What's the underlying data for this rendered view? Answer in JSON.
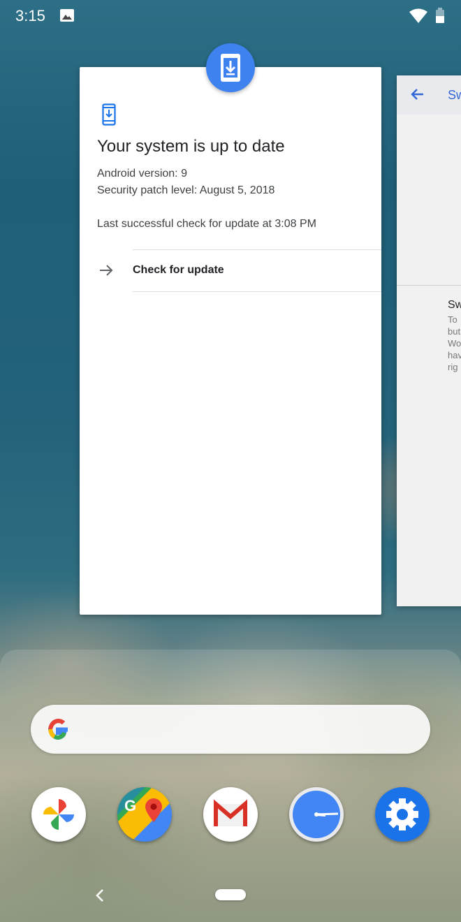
{
  "status_bar": {
    "time": "3:15",
    "notification_icon": "image-icon",
    "wifi_icon": "wifi-icon",
    "battery_icon": "battery-icon"
  },
  "recents": {
    "active_card": {
      "app_icon": "system-update-icon",
      "header_icon": "phone-download-icon",
      "title": "Your system is up to date",
      "android_version": "Android version: 9",
      "security_patch": "Security patch level: August 5, 2018",
      "last_check": "Last successful check for update at 3:08 PM",
      "action_label": "Check for update"
    },
    "next_card": {
      "title": "Sw",
      "heading": "Sw",
      "lines": [
        "To",
        "but",
        "Wo",
        "hav",
        "rig"
      ]
    }
  },
  "dock": {
    "search_logo": "google-g-logo",
    "apps": [
      {
        "name": "photos-app-icon"
      },
      {
        "name": "maps-app-icon"
      },
      {
        "name": "gmail-app-icon"
      },
      {
        "name": "clock-app-icon"
      },
      {
        "name": "settings-app-icon"
      }
    ]
  },
  "navigation": {
    "back_icon": "back-chevron-icon",
    "home_pill": "home-pill"
  },
  "colors": {
    "accent": "#3e82f0",
    "link": "#3367d6"
  }
}
